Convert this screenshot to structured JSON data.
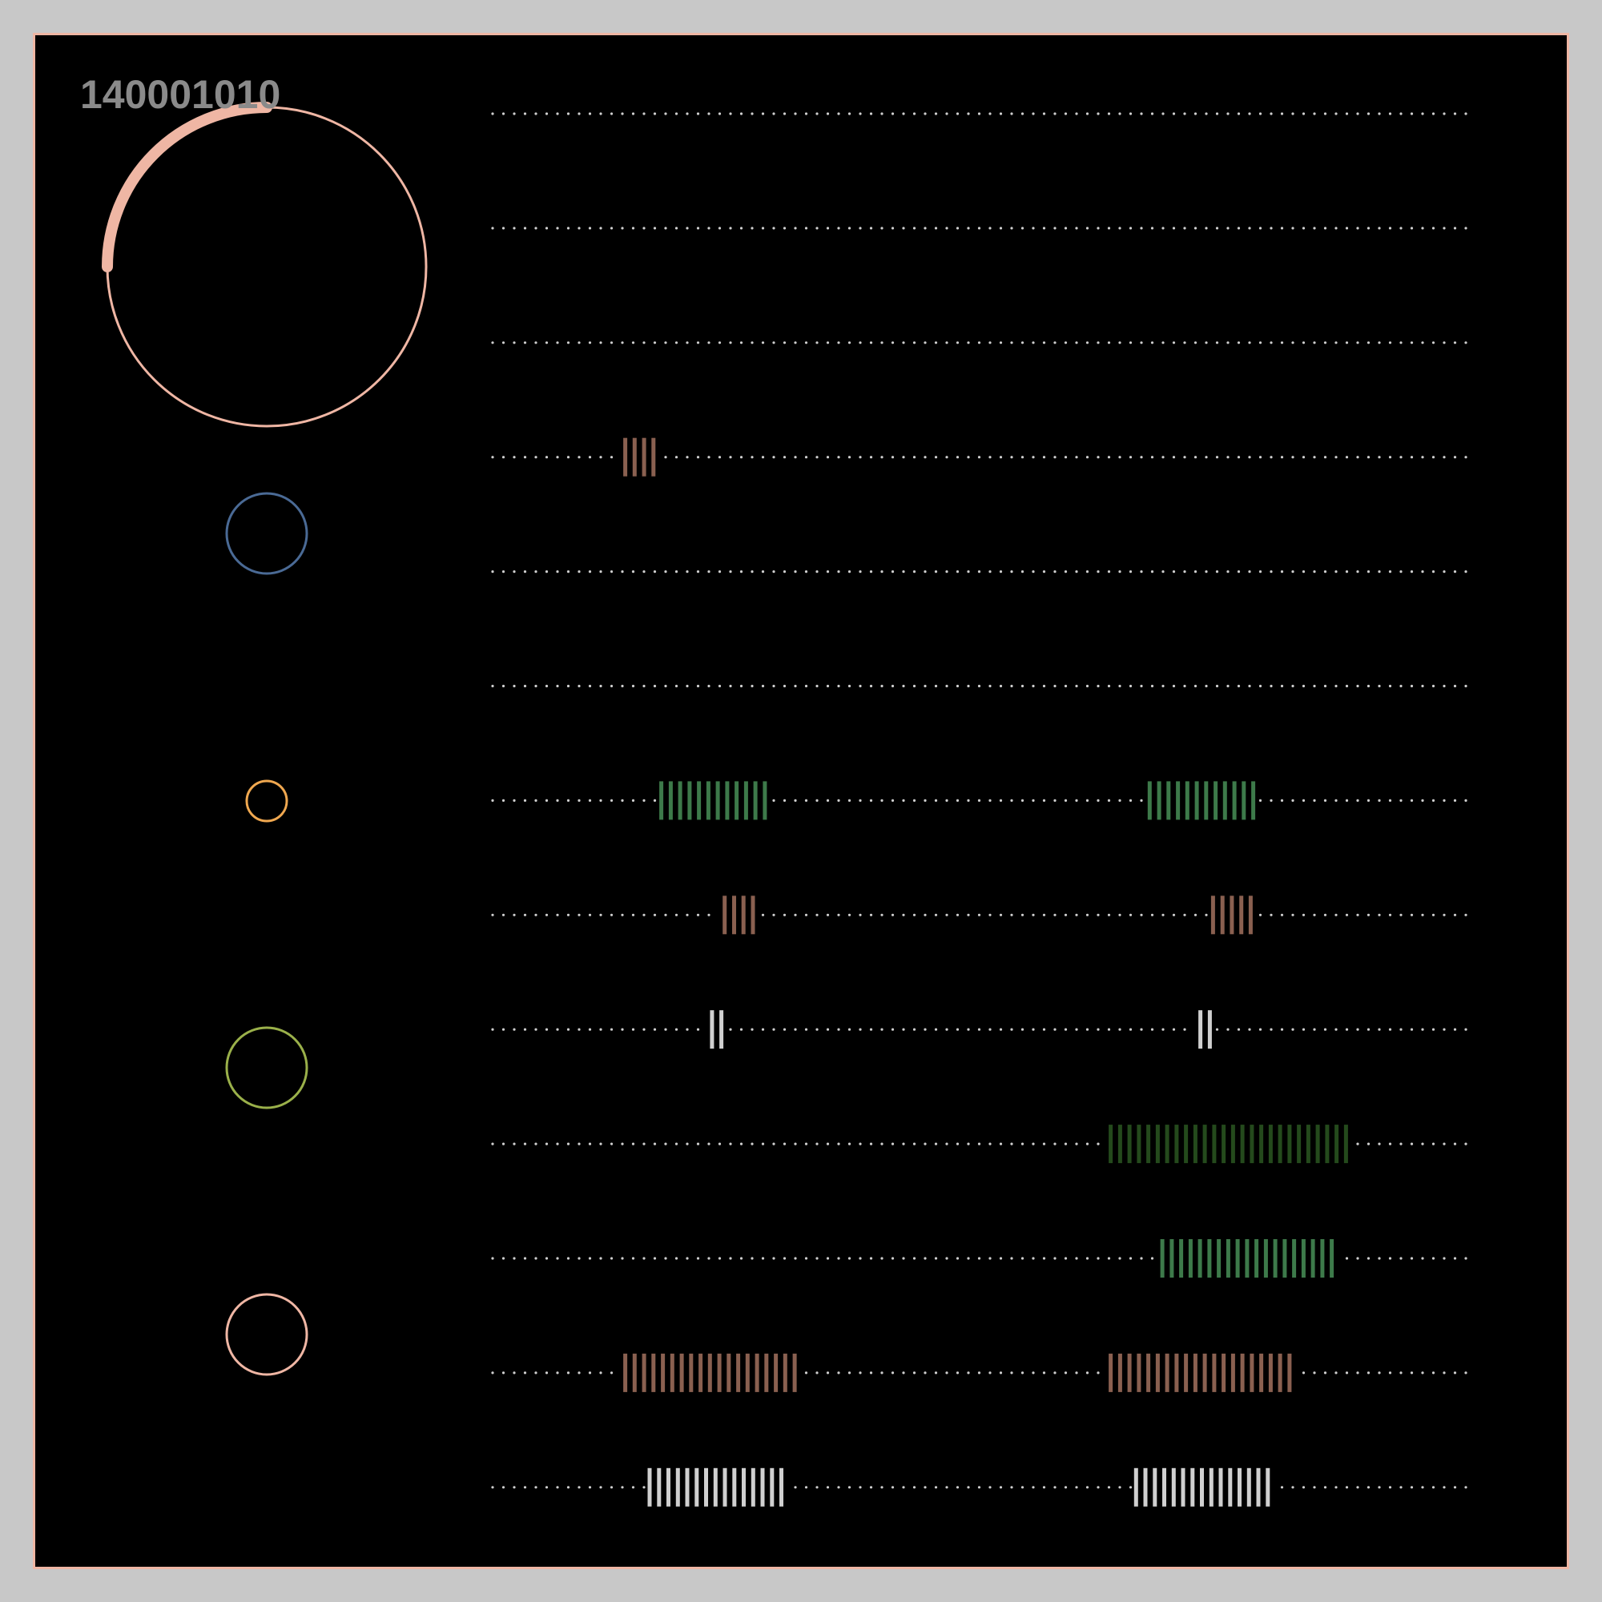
{
  "counter": {
    "value": "140001010"
  },
  "progress": {
    "fraction": 0.25,
    "color": "#efb6a4"
  },
  "colors": {
    "background": "#000000",
    "outer": "#c8c8c8",
    "border": "#efb6a4",
    "dots": "#cfcfcf"
  },
  "indicators": [
    {
      "color": "#4a6a95",
      "size": "medium"
    },
    {
      "color": "#f0a850",
      "size": "small"
    },
    {
      "color": "#9ab04a",
      "size": "medium"
    },
    {
      "color": "#efb6a4",
      "size": "medium"
    }
  ],
  "tracks": [
    {
      "color": "#8a6050",
      "segments": []
    },
    {
      "color": "#8a6050",
      "segments": []
    },
    {
      "color": "#8a6050",
      "segments": []
    },
    {
      "color": "#8a6050",
      "segments": [
        [
          0.134,
          4
        ]
      ]
    },
    {
      "color": "#8a6050",
      "segments": []
    },
    {
      "color": "#8a6050",
      "segments": []
    },
    {
      "color": "#3d7a4a",
      "segments": [
        [
          0.171,
          12
        ],
        [
          0.672,
          12
        ]
      ]
    },
    {
      "color": "#8a6050",
      "segments": [
        [
          0.236,
          4
        ],
        [
          0.737,
          5
        ]
      ]
    },
    {
      "color": "#d0d0d0",
      "segments": [
        [
          0.223,
          2
        ],
        [
          0.724,
          2
        ]
      ]
    },
    {
      "color": "#244a1c",
      "segments": [
        [
          0.632,
          26
        ]
      ]
    },
    {
      "color": "#3d7a4a",
      "segments": [
        [
          0.685,
          19
        ]
      ]
    },
    {
      "color": "#8a6050",
      "segments": [
        [
          0.134,
          19
        ],
        [
          0.632,
          20
        ]
      ]
    },
    {
      "color": "#d0d0d0",
      "segments": [
        [
          0.159,
          15
        ],
        [
          0.658,
          15
        ]
      ]
    }
  ]
}
